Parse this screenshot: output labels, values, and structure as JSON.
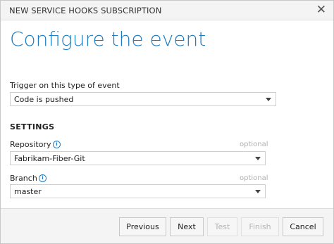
{
  "dialog": {
    "title": "NEW SERVICE HOOKS SUBSCRIPTION",
    "close_glyph": "✕",
    "heading": "Configure the event"
  },
  "trigger": {
    "label": "Trigger on this type of event",
    "value": "Code is pushed"
  },
  "settings": {
    "heading": "SETTINGS",
    "repository": {
      "label": "Repository",
      "optional": "optional",
      "value": "Fabrikam-Fiber-Git"
    },
    "branch": {
      "label": "Branch",
      "optional": "optional",
      "value": "master"
    }
  },
  "buttons": {
    "previous": "Previous",
    "next": "Next",
    "test": "Test",
    "finish": "Finish",
    "cancel": "Cancel"
  },
  "colors": {
    "accent": "#1e7dc1",
    "footer_bg": "#f4f4f4"
  },
  "icons": {
    "info": "info-icon",
    "close": "close-icon",
    "dropdown": "chevron-down-icon"
  }
}
